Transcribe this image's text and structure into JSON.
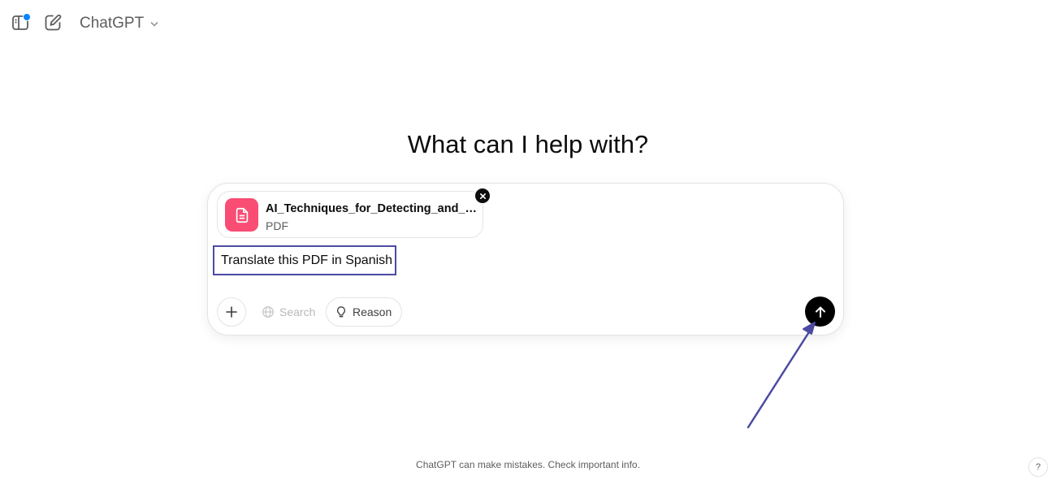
{
  "app": {
    "model_name": "ChatGPT"
  },
  "header": {
    "icons": {
      "sidebar": "sidebar-toggle-icon",
      "new_chat": "new-chat-icon",
      "model_menu": "chevron-down-icon"
    },
    "notification_color": "#0a84ff"
  },
  "main": {
    "heading": "What can I help with?"
  },
  "composer": {
    "attachment": {
      "name": "AI_Techniques_for_Detecting_and_Dia...",
      "type": "PDF",
      "icon": "document-icon",
      "icon_color": "#fa4d74"
    },
    "prompt": "Translate this PDF in Spanish",
    "highlight_color": "#4b4ba3",
    "tools": {
      "search_label": "Search",
      "reason_label": "Reason"
    },
    "send_icon": "arrow-up-icon"
  },
  "footer": {
    "disclaimer": "ChatGPT can make mistakes. Check important info.",
    "help_label": "?"
  }
}
